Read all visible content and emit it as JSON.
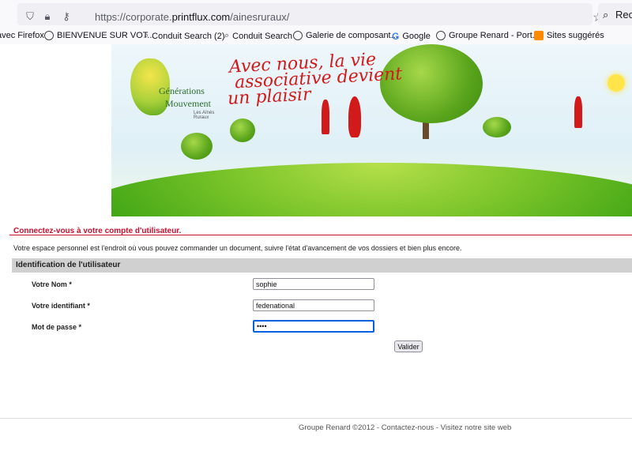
{
  "browser": {
    "url_prefix": "https://corporate.",
    "url_domain": "printflux.com",
    "url_path": "/ainesruraux/",
    "search_text": "Rech"
  },
  "bookmarks": [
    {
      "label": "avec Firefox",
      "icon": "none"
    },
    {
      "label": "BIENVENUE SUR VOT...",
      "icon": "globe-icon"
    },
    {
      "label": "Conduit Search (2)",
      "icon": "search-icon"
    },
    {
      "label": "Conduit Search",
      "icon": "search-icon"
    },
    {
      "label": "Galerie de composant...",
      "icon": "globe-icon"
    },
    {
      "label": "Google",
      "icon": "google-icon"
    },
    {
      "label": "Groupe Renard - Port...",
      "icon": "globe-icon"
    },
    {
      "label": "Sites suggérés",
      "icon": "suggested-icon"
    }
  ],
  "banner": {
    "logo_line1": "Générations",
    "logo_line2": "Mouvement",
    "logo_line3": "Les Aînés Ruraux",
    "slogan_line1": "Avec nous, la vie",
    "slogan_line2": "associative devient",
    "slogan_line3": "un plaisir"
  },
  "page": {
    "heading": "Connectez-vous à votre compte d'utilisateur.",
    "intro": "Votre espace personnel est l'endroit où vous pouvez commander un document, suivre l'état d'avancement de vos dossiers et bien plus encore.",
    "section_title": "Identification de l'utilisateur"
  },
  "form": {
    "name_label": "Votre Nom *",
    "name_value": "sophie",
    "login_label": "Votre identifiant *",
    "login_value": "fedenational",
    "password_label": "Mot de passe *",
    "password_value": "••••",
    "submit_label": "Valider"
  },
  "footer": {
    "text": "Groupe Renard ©2012 - Contactez-nous - Visitez notre site web"
  }
}
